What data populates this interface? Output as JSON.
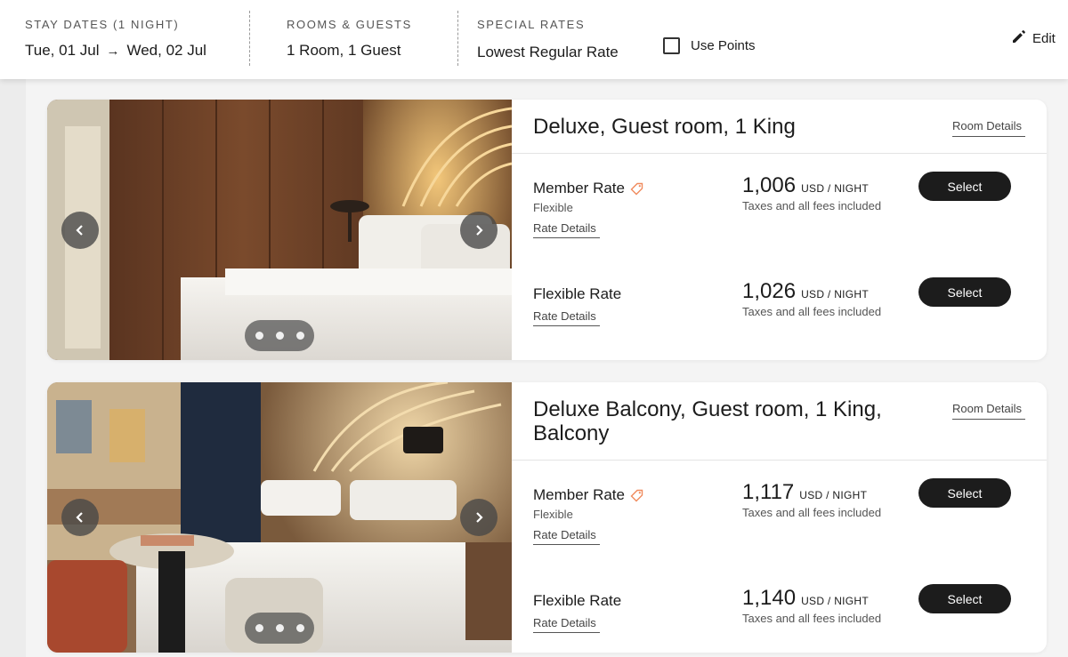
{
  "header": {
    "stay_label": "STAY DATES (1 NIGHT)",
    "check_in": "Tue, 01 Jul",
    "check_out": "Wed, 02 Jul",
    "rooms_label": "ROOMS & GUESTS",
    "rooms_value": "1 Room, 1 Guest",
    "rates_label": "SPECIAL RATES",
    "rates_value": "Lowest Regular Rate",
    "use_points_label": "Use Points",
    "use_points_checked": false,
    "edit_label": "Edit"
  },
  "rooms": [
    {
      "title": "Deluxe, Guest room, 1 King",
      "details_link": "Room Details",
      "photo_index": 1,
      "photo_count": 3,
      "rates": [
        {
          "name": "Member Rate",
          "has_tag_icon": true,
          "sub": "Flexible",
          "details_link": "Rate Details",
          "price": "1,006",
          "unit": "USD / NIGHT",
          "note": "Taxes and all fees included",
          "button": "Select"
        },
        {
          "name": "Flexible Rate",
          "has_tag_icon": false,
          "sub": "",
          "details_link": "Rate Details",
          "price": "1,026",
          "unit": "USD / NIGHT",
          "note": "Taxes and all fees included",
          "button": "Select"
        }
      ]
    },
    {
      "title": "Deluxe Balcony, Guest room, 1 King, Balcony",
      "details_link": "Room Details",
      "photo_index": 1,
      "photo_count": 3,
      "rates": [
        {
          "name": "Member Rate",
          "has_tag_icon": true,
          "sub": "Flexible",
          "details_link": "Rate Details",
          "price": "1,117",
          "unit": "USD / NIGHT",
          "note": "Taxes and all fees included",
          "button": "Select"
        },
        {
          "name": "Flexible Rate",
          "has_tag_icon": false,
          "sub": "",
          "details_link": "Rate Details",
          "price": "1,140",
          "unit": "USD / NIGHT",
          "note": "Taxes and all fees included",
          "button": "Select"
        }
      ]
    }
  ],
  "icons": {
    "arrow": "arrow-right-icon",
    "edit": "pencil-icon",
    "tag": "tag-icon",
    "prev": "chevron-left-icon",
    "next": "chevron-right-icon"
  },
  "colors": {
    "button_bg": "#1c1c1c",
    "tag_accent": "#f08a5d",
    "page_bg": "#f4f4f4"
  }
}
